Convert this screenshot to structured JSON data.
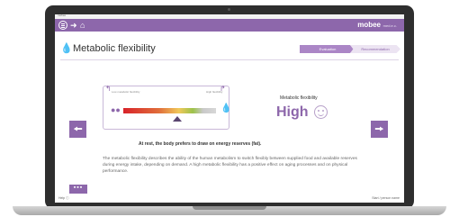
{
  "window": {
    "title": "mobee"
  },
  "header": {
    "back_icon": "arrow-left-icon",
    "home_icon": "home-icon",
    "brand": "mobee",
    "brand_sub": "med.e.c."
  },
  "page": {
    "title": "Metabolic flexibility",
    "icon": "drop-icon"
  },
  "steps": [
    "Evaluation",
    "Recommendation"
  ],
  "gauge": {
    "label_low": "Low metabolic flexibility",
    "label_high": "High flexibility",
    "pointer_level": 0.58
  },
  "result": {
    "label": "Metabolic flexibility",
    "value": "High",
    "icon": "smiley-icon"
  },
  "statement": "At rest, the body prefers to draw on energy reserves (fat).",
  "description": "The metabolic flexibility describes the ability of the human metabolism to switch flexibly between supplied food and available reserves during energy intake, depending on demand. A high metabolic flexibility has a positive effect on aging processes and on physical performance.",
  "more_label": "▪▪▪",
  "footer": {
    "left": "Help ⓘ",
    "right": "Start / person name"
  },
  "colors": {
    "accent": "#8d67ab",
    "bar_low": "#d8232a",
    "bar_mid": "#f0c85a",
    "bar_high": "#9cc24a"
  }
}
